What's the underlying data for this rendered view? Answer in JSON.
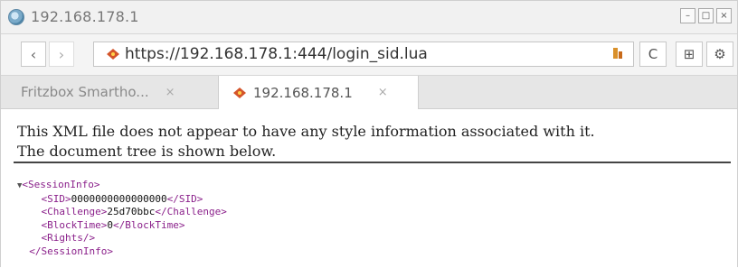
{
  "window": {
    "title": "192.168.178.1",
    "controls": {
      "minimize": "–",
      "maximize": "□",
      "close": "×"
    }
  },
  "toolbar": {
    "back_icon": "‹",
    "forward_icon": "›",
    "url": "https://192.168.178.1:444/login_sid.lua",
    "reload_icon": "C",
    "bookmark_icon": "⊞",
    "settings_icon": "⚙"
  },
  "tabs": [
    {
      "label": "Fritzbox Smartho...",
      "close": "×",
      "active": false
    },
    {
      "label": "192.168.178.1",
      "close": "×",
      "active": true
    }
  ],
  "page": {
    "notice_line1": "This XML file does not appear to have any style information associated with it.",
    "notice_line2": "The document tree is shown below.",
    "xml": {
      "toggle": "▼",
      "open_root": "<SessionInfo>",
      "sid_open": "<SID>",
      "sid_value": "0000000000000000",
      "sid_close": "</SID>",
      "challenge_open": "<Challenge>",
      "challenge_value": "25d70bbc",
      "challenge_close": "</Challenge>",
      "blocktime_open": "<BlockTime>",
      "blocktime_value": "0",
      "blocktime_close": "</BlockTime>",
      "rights": "<Rights/>",
      "close_root": "</SessionInfo>"
    }
  },
  "colors": {
    "xml_tag": "#8a1f8a",
    "security_icon": "#d4542a"
  }
}
